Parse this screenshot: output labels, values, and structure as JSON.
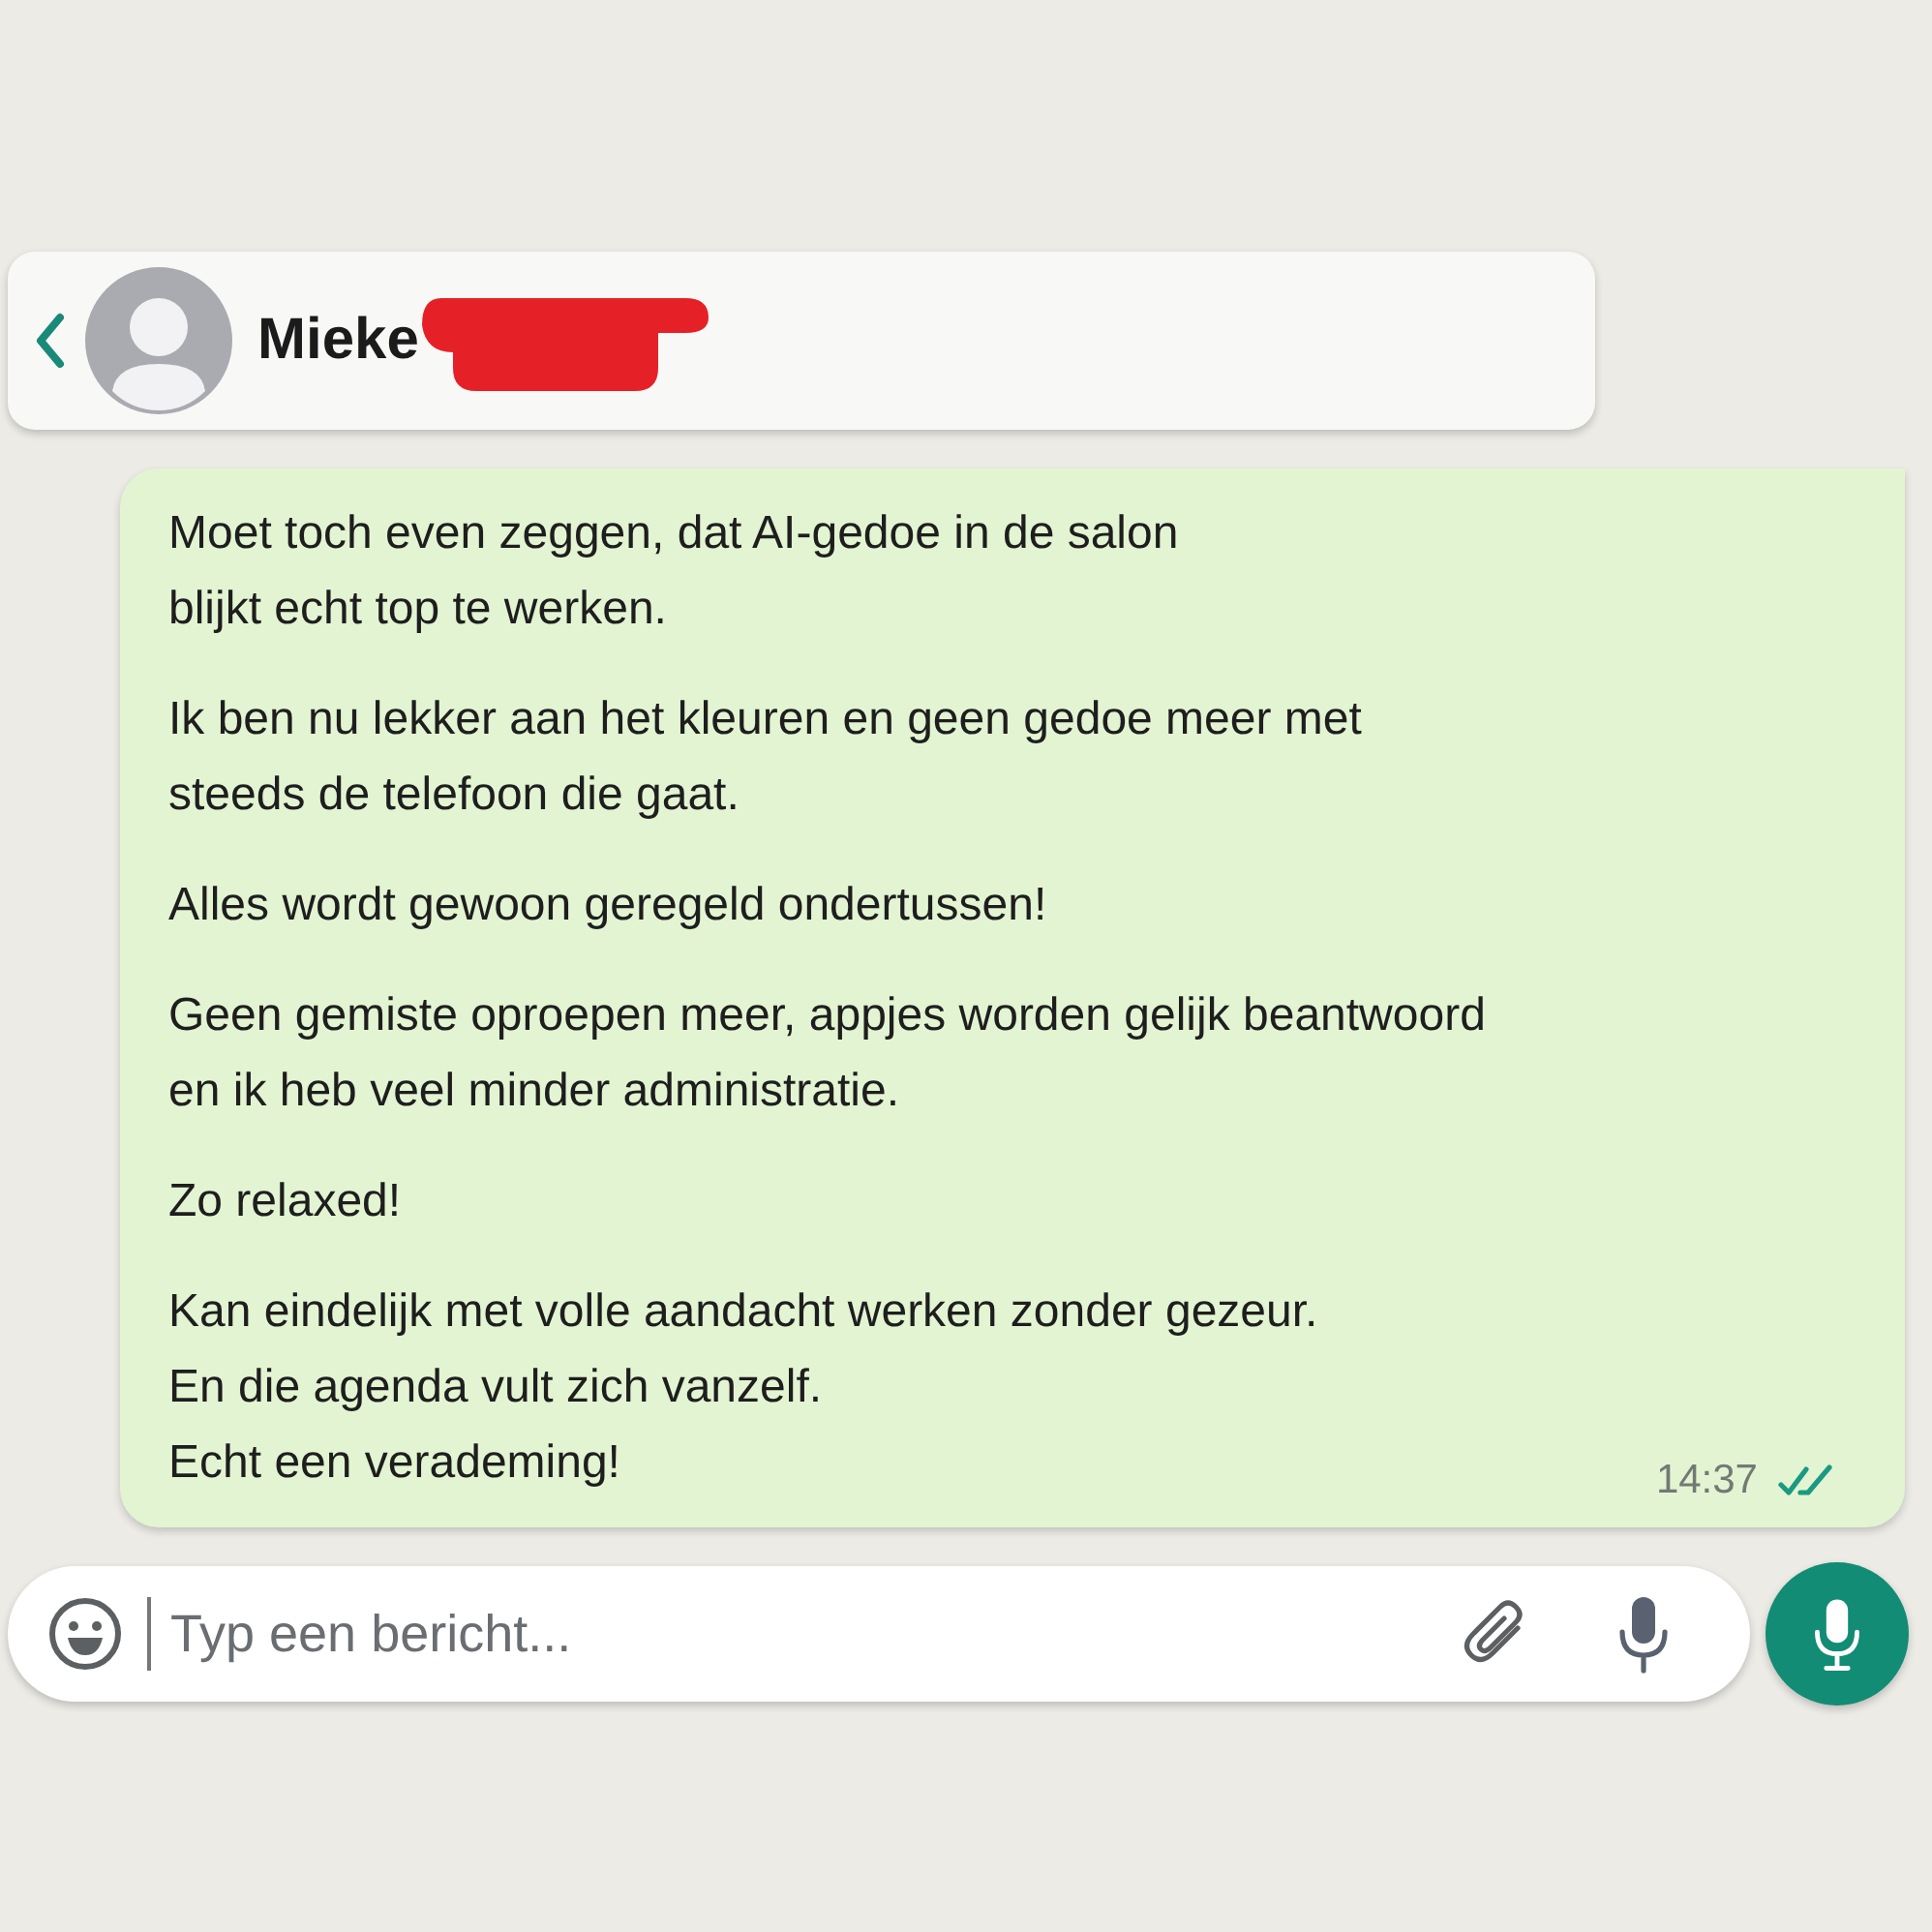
{
  "header": {
    "contact_name": "Mieke",
    "name_redacted": true
  },
  "message": {
    "paragraphs": [
      [
        "Moet toch even zeggen, dat AI-gedoe in de salon",
        "blijkt echt top te werken."
      ],
      [
        "Ik ben nu lekker aan het kleuren en geen gedoe meer met",
        "steeds de telefoon die gaat."
      ],
      [
        "Alles wordt gewoon geregeld ondertussen!"
      ],
      [
        "Geen gemiste oproepen meer, appjes worden gelijk beantwoord",
        "en ik heb veel minder administratie."
      ],
      [
        "Zo relaxed!"
      ],
      [
        "Kan eindelijk met volle aandacht werken zonder gezeur.",
        "En die agenda vult zich vanzelf.",
        "Echt een verademing!"
      ]
    ],
    "time": "14:37",
    "read": true
  },
  "composer": {
    "placeholder": "Typ een bericht..."
  }
}
